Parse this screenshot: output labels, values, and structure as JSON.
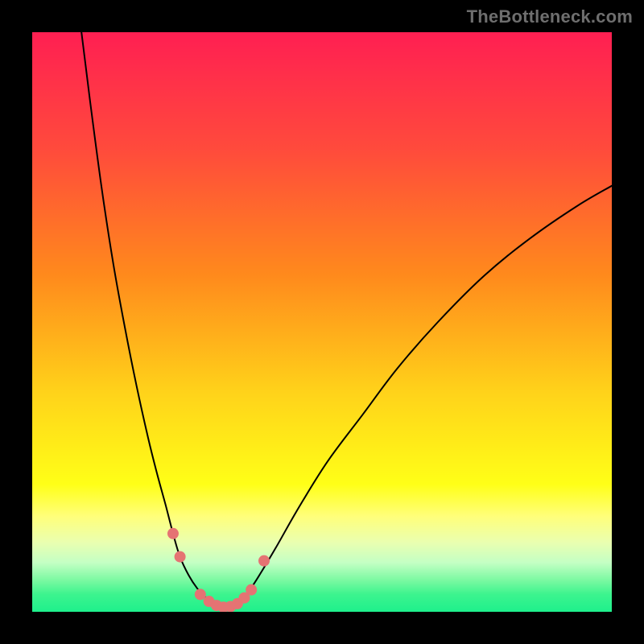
{
  "watermark": "TheBottleneck.com",
  "chart_data": {
    "type": "line",
    "title": "",
    "xlabel": "",
    "ylabel": "",
    "xlim": [
      0,
      100
    ],
    "ylim": [
      0,
      100
    ],
    "grid": false,
    "legend": false,
    "background_gradient": {
      "direction": "vertical_top_to_bottom",
      "stops": [
        {
          "pos": 0.0,
          "color": "#ff1f52"
        },
        {
          "pos": 0.2,
          "color": "#ff4a3c"
        },
        {
          "pos": 0.42,
          "color": "#ff8a1c"
        },
        {
          "pos": 0.62,
          "color": "#ffd21a"
        },
        {
          "pos": 0.78,
          "color": "#ffff17"
        },
        {
          "pos": 0.835,
          "color": "#ffff7a"
        },
        {
          "pos": 0.88,
          "color": "#eaffb0"
        },
        {
          "pos": 0.915,
          "color": "#c4ffc4"
        },
        {
          "pos": 0.945,
          "color": "#7cf9a2"
        },
        {
          "pos": 0.97,
          "color": "#3cf48e"
        },
        {
          "pos": 1.0,
          "color": "#1ef08c"
        }
      ]
    },
    "series": [
      {
        "name": "left-curve",
        "color": "#000000",
        "x": [
          8.5,
          10,
          12,
          14,
          16,
          18,
          20,
          21.5,
          23,
          24.3,
          25.5,
          27,
          28.5,
          30,
          31.5
        ],
        "y": [
          100,
          88,
          73,
          60,
          49,
          39,
          30,
          24,
          18.5,
          13.5,
          9.5,
          6.3,
          4.0,
          2.4,
          1.3
        ]
      },
      {
        "name": "right-curve",
        "color": "#000000",
        "x": [
          35.5,
          37,
          39,
          42,
          46,
          51,
          57,
          63,
          70,
          78,
          86,
          94,
          100
        ],
        "y": [
          1.5,
          3.0,
          6.0,
          11,
          18,
          26,
          34,
          42,
          50,
          58,
          64.5,
          70,
          73.5
        ]
      },
      {
        "name": "valley-floor",
        "color": "#000000",
        "x": [
          31.5,
          32.3,
          33.0,
          33.7,
          34.5,
          35.5
        ],
        "y": [
          1.3,
          0.9,
          0.7,
          0.7,
          0.9,
          1.5
        ]
      }
    ],
    "markers": [
      {
        "name": "left-marker-upper",
        "x": 24.3,
        "y": 13.5,
        "r": 7,
        "color": "#e57373"
      },
      {
        "name": "left-marker-lower",
        "x": 25.5,
        "y": 9.5,
        "r": 7,
        "color": "#e57373"
      },
      {
        "name": "floor-marker-1",
        "x": 29.0,
        "y": 3.0,
        "r": 7,
        "color": "#e57373"
      },
      {
        "name": "floor-marker-2",
        "x": 30.5,
        "y": 1.8,
        "r": 7,
        "color": "#e57373"
      },
      {
        "name": "floor-marker-3",
        "x": 31.8,
        "y": 1.1,
        "r": 7,
        "color": "#e57373"
      },
      {
        "name": "floor-marker-4",
        "x": 33.0,
        "y": 0.8,
        "r": 7,
        "color": "#e57373"
      },
      {
        "name": "floor-marker-5",
        "x": 34.2,
        "y": 0.9,
        "r": 7,
        "color": "#e57373"
      },
      {
        "name": "floor-marker-6",
        "x": 35.4,
        "y": 1.4,
        "r": 7,
        "color": "#e57373"
      },
      {
        "name": "floor-marker-7",
        "x": 36.6,
        "y": 2.4,
        "r": 7,
        "color": "#e57373"
      },
      {
        "name": "floor-marker-8",
        "x": 37.8,
        "y": 3.8,
        "r": 7,
        "color": "#e57373"
      },
      {
        "name": "right-marker-upper",
        "x": 40.0,
        "y": 8.8,
        "r": 7,
        "color": "#e57373"
      }
    ]
  }
}
